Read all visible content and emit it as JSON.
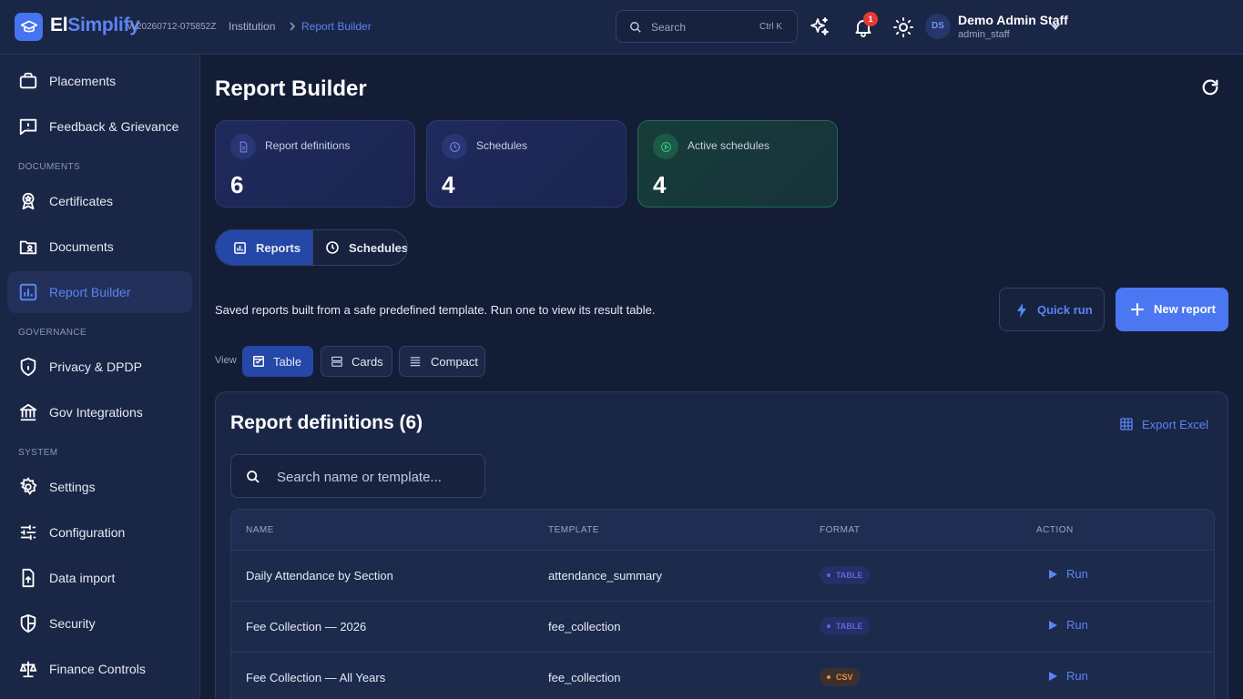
{
  "header": {
    "brand_prefix": "El",
    "brand_suffix": "Simplify",
    "version": "vv20260712-075852Z",
    "breadcrumb": [
      "Institution",
      "Report Builder"
    ],
    "search_placeholder": "Search",
    "search_shortcut": "Ctrl K",
    "notification_count": "1",
    "user": {
      "initials": "DS",
      "name": "Demo Admin Staff",
      "role": "admin_staff"
    }
  },
  "sidebar": {
    "items_top": [
      {
        "label": "Placements",
        "icon": "briefcase-icon"
      },
      {
        "label": "Feedback & Grievance",
        "icon": "message-alert-icon"
      }
    ],
    "section_documents": "DOCUMENTS",
    "items_documents": [
      {
        "label": "Certificates",
        "icon": "award-icon"
      },
      {
        "label": "Documents",
        "icon": "folder-icon"
      },
      {
        "label": "Report Builder",
        "icon": "bar-chart-icon",
        "active": true
      }
    ],
    "section_governance": "GOVERNANCE",
    "items_governance": [
      {
        "label": "Privacy & DPDP",
        "icon": "shield-info-icon"
      },
      {
        "label": "Gov Integrations",
        "icon": "bank-icon"
      }
    ],
    "section_system": "SYSTEM",
    "items_system": [
      {
        "label": "Settings",
        "icon": "gear-icon"
      },
      {
        "label": "Configuration",
        "icon": "sliders-icon"
      },
      {
        "label": "Data import",
        "icon": "file-upload-icon"
      },
      {
        "label": "Security",
        "icon": "shield-icon"
      },
      {
        "label": "Finance Controls",
        "icon": "scale-icon"
      }
    ]
  },
  "main": {
    "title": "Report Builder",
    "stats": [
      {
        "label": "Report definitions",
        "value": "6",
        "icon": "file-icon"
      },
      {
        "label": "Schedules",
        "value": "4",
        "icon": "clock-icon"
      },
      {
        "label": "Active schedules",
        "value": "4",
        "icon": "play-circle-icon"
      }
    ],
    "tabs": [
      {
        "label": "Reports",
        "active": true
      },
      {
        "label": "Schedules",
        "active": false
      }
    ],
    "description": "Saved reports built from a safe predefined template. Run one to view its result table.",
    "quick_run_label": "Quick run",
    "new_report_label": "New report",
    "view_label": "View",
    "views": [
      {
        "label": "Table",
        "active": true
      },
      {
        "label": "Cards",
        "active": false
      },
      {
        "label": "Compact",
        "active": false
      }
    ],
    "panel_title": "Report definitions  (6)",
    "export_label": "Export Excel",
    "table_search_placeholder": "Search name or template...",
    "columns": [
      "NAME",
      "TEMPLATE",
      "FORMAT",
      "ACTION"
    ],
    "rows": [
      {
        "name": "Daily Attendance by Section",
        "template": "attendance_summary",
        "format": "TABLE",
        "action": "Run"
      },
      {
        "name": "Fee Collection — 2026",
        "template": "fee_collection",
        "format": "TABLE",
        "action": "Run"
      },
      {
        "name": "Fee Collection — All Years",
        "template": "fee_collection",
        "format": "CSV",
        "action": "Run"
      }
    ]
  },
  "colors": {
    "accent": "#4b78f2",
    "background": "#131d36",
    "surface": "#1a2646",
    "badge_table": "#5a67d8",
    "badge_csv": "#f28c28",
    "notification": "#e53935"
  }
}
